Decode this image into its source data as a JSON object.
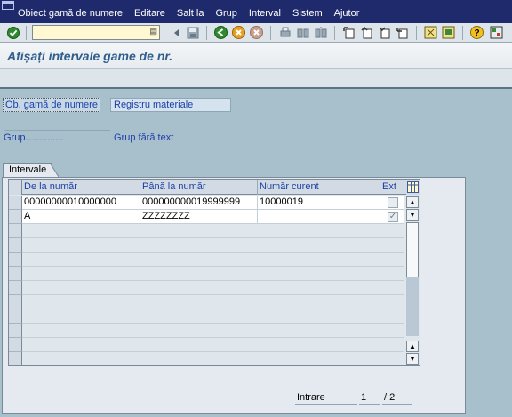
{
  "menu": {
    "items": [
      "Obiect gamă de numere",
      "Editare",
      "Salt la",
      "Grup",
      "Interval",
      "Sistem",
      "Ajutor"
    ]
  },
  "toolbar": {
    "command_value": "",
    "icons": [
      "enter-check-icon",
      "history-icon",
      "back-arrow-icon",
      "save-icon",
      "back-icon",
      "exit-icon",
      "cancel-icon",
      "print-icon",
      "find-icon",
      "find-next-icon",
      "first-page-icon",
      "previous-page-icon",
      "next-page-icon",
      "last-page-icon",
      "create-session-icon",
      "shortcut-icon",
      "help-icon",
      "layout-icon"
    ]
  },
  "title": "Afișați intervale game de nr.",
  "header": {
    "object_label": "Ob. gamă de numere",
    "object_value": "Registru materiale",
    "group_label": "Grup..............",
    "group_value": "Grup fără text"
  },
  "tab": {
    "label": "Intervale"
  },
  "table": {
    "columns": [
      "De la număr",
      "Până la număr",
      "Număr curent",
      "Ext"
    ],
    "rows": [
      {
        "from": "00000000010000000",
        "to": "000000000019999999",
        "current": "10000019",
        "ext": false
      },
      {
        "from": "A",
        "to": "ZZZZZZZZ",
        "current": "",
        "ext": true
      }
    ],
    "empty_rows": 9
  },
  "footer": {
    "entry_label": "Intrare",
    "entry_current": "1",
    "entry_total": "/ 2"
  },
  "colors": {
    "menubar": "#1e2a6b",
    "title": "#2f5d8c",
    "background": "#a8bfcc",
    "label": "#1c3fa8"
  }
}
